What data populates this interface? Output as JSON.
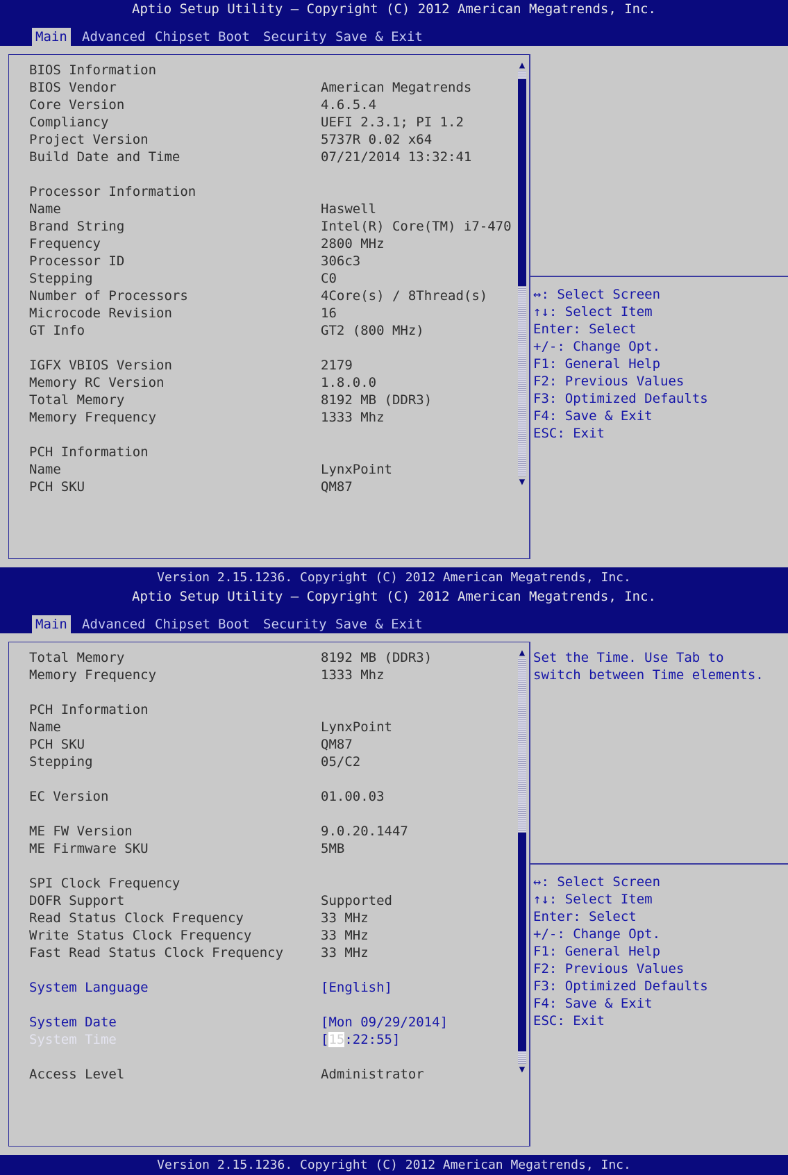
{
  "screens": [
    {
      "title": "Aptio Setup Utility – Copyright (C) 2012 American Megatrends, Inc.",
      "tabs": [
        "Main",
        "Advanced",
        "Chipset",
        "Boot",
        "Security",
        "Save & Exit"
      ],
      "active_tab": "Main",
      "rows": [
        {
          "label": "BIOS Information",
          "value": ""
        },
        {
          "label": "BIOS Vendor",
          "value": "American Megatrends"
        },
        {
          "label": "Core Version",
          "value": "4.6.5.4"
        },
        {
          "label": "Compliancy",
          "value": "UEFI 2.3.1; PI 1.2"
        },
        {
          "label": "Project Version",
          "value": "5737R 0.02 x64"
        },
        {
          "label": "Build Date and Time",
          "value": "07/21/2014 13:32:41"
        },
        {
          "label": "",
          "value": ""
        },
        {
          "label": "Processor Information",
          "value": ""
        },
        {
          "label": "Name",
          "value": "Haswell"
        },
        {
          "label": "Brand String",
          "value": "Intel(R) Core(TM) i7-470"
        },
        {
          "label": "Frequency",
          "value": "2800 MHz"
        },
        {
          "label": "Processor ID",
          "value": "306c3"
        },
        {
          "label": "Stepping",
          "value": "C0"
        },
        {
          "label": "Number of Processors",
          "value": "4Core(s) / 8Thread(s)"
        },
        {
          "label": "Microcode Revision",
          "value": "16"
        },
        {
          "label": "GT Info",
          "value": "GT2 (800 MHz)"
        },
        {
          "label": "",
          "value": ""
        },
        {
          "label": "IGFX VBIOS Version",
          "value": "2179"
        },
        {
          "label": "Memory RC Version",
          "value": "1.8.0.0"
        },
        {
          "label": "Total Memory",
          "value": "8192 MB (DDR3)"
        },
        {
          "label": "Memory Frequency",
          "value": "1333 Mhz"
        },
        {
          "label": "",
          "value": ""
        },
        {
          "label": "PCH Information",
          "value": ""
        },
        {
          "label": "Name",
          "value": "LynxPoint"
        },
        {
          "label": "PCH SKU",
          "value": "QM87"
        }
      ],
      "help_text": [],
      "keys": [
        "↔: Select Screen",
        "↑↓: Select Item",
        "Enter: Select",
        "+/-: Change Opt.",
        "F1: General Help",
        "F2: Previous Values",
        "F3: Optimized Defaults",
        "F4: Save & Exit",
        "ESC: Exit"
      ],
      "footer": "Version 2.15.1236. Copyright (C) 2012 American Megatrends, Inc."
    },
    {
      "title": "Aptio Setup Utility – Copyright (C) 2012 American Megatrends, Inc.",
      "tabs": [
        "Main",
        "Advanced",
        "Chipset",
        "Boot",
        "Security",
        "Save & Exit"
      ],
      "active_tab": "Main",
      "rows": [
        {
          "label": "Total Memory",
          "value": "8192 MB (DDR3)"
        },
        {
          "label": "Memory Frequency",
          "value": "1333 Mhz"
        },
        {
          "label": "",
          "value": ""
        },
        {
          "label": "PCH Information",
          "value": ""
        },
        {
          "label": "Name",
          "value": "LynxPoint"
        },
        {
          "label": "PCH SKU",
          "value": "QM87"
        },
        {
          "label": "Stepping",
          "value": "05/C2"
        },
        {
          "label": "",
          "value": ""
        },
        {
          "label": "EC Version",
          "value": "01.00.03"
        },
        {
          "label": "",
          "value": ""
        },
        {
          "label": "ME FW Version",
          "value": "9.0.20.1447"
        },
        {
          "label": "ME Firmware SKU",
          "value": "5MB"
        },
        {
          "label": "",
          "value": ""
        },
        {
          "label": "SPI Clock Frequency",
          "value": ""
        },
        {
          "label": "DOFR Support",
          "value": "Supported"
        },
        {
          "label": "Read Status Clock Frequency",
          "value": "33 MHz"
        },
        {
          "label": "Write Status Clock Frequency",
          "value": "33 MHz"
        },
        {
          "label": "Fast Read Status Clock Frequency",
          "value": "33 MHz"
        },
        {
          "label": "",
          "value": ""
        },
        {
          "label": "System Language",
          "value": "[English]",
          "editable": true
        },
        {
          "label": "",
          "value": ""
        },
        {
          "label": "System Date",
          "value": "[Mon 09/29/2014]",
          "editable": true
        },
        {
          "label": "System Time",
          "value_prefix": "[",
          "value_cursor": "15",
          "value_suffix": ":22:55]",
          "editable": true,
          "selected": true
        },
        {
          "label": "",
          "value": ""
        },
        {
          "label": "Access Level",
          "value": "Administrator"
        }
      ],
      "help_text": [
        "Set the Time. Use Tab to",
        "switch between Time elements."
      ],
      "keys": [
        "↔: Select Screen",
        "↑↓: Select Item",
        "Enter: Select",
        "+/-: Change Opt.",
        "F1: General Help",
        "F2: Previous Values",
        "F3: Optimized Defaults",
        "F4: Save & Exit",
        "ESC: Exit"
      ],
      "footer": "Version 2.15.1236. Copyright (C) 2012 American Megatrends, Inc."
    }
  ],
  "colors": {
    "header_bg": "#0a0a7e",
    "panel_bg": "#c9c9c9",
    "label_text": "#303030",
    "editable_text": "#1616a8",
    "help_text": "#1616a8",
    "scroll_thumb": "#0a0a7e"
  },
  "scroll_state": [
    {
      "thumb_start_fraction": 0.02,
      "thumb_end_fraction": 0.53
    },
    {
      "thumb_start_fraction": 0.43,
      "thumb_end_fraction": 0.97
    }
  ]
}
